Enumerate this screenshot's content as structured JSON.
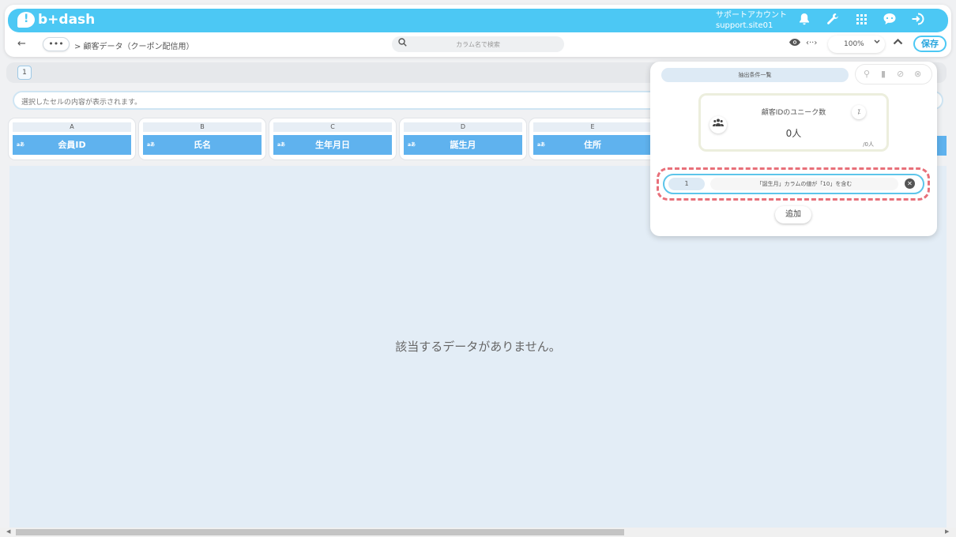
{
  "app": {
    "logo_text": "b+dash"
  },
  "account": {
    "label": "サポートアカウント",
    "id": "support.site01"
  },
  "toolbar_icons": [
    "bell-icon",
    "wrench-icon",
    "grid-icon",
    "chat-icon",
    "logout-icon"
  ],
  "nav": {
    "back": "←",
    "more": "•••",
    "breadcrumb": "> 顧客データ（クーポン配信用）",
    "search_placeholder": "カラム名で検索",
    "code_toggle": "‹··›",
    "zoom": "100%",
    "save_label": "保存"
  },
  "page": {
    "current": "1"
  },
  "cell_view_placeholder": "選択したセルの内容が表示されます。",
  "columns": [
    {
      "letter": "A",
      "type": "aあ",
      "name": "会員ID"
    },
    {
      "letter": "B",
      "type": "aあ",
      "name": "氏名"
    },
    {
      "letter": "C",
      "type": "aあ",
      "name": "生年月日"
    },
    {
      "letter": "D",
      "type": "aあ",
      "name": "誕生月"
    },
    {
      "letter": "E",
      "type": "aあ",
      "name": "住所"
    }
  ],
  "empty_message": "該当するデータがありません。",
  "panel": {
    "tab_label": "抽出条件一覧",
    "stat": {
      "title": "顧客IDのユニーク数",
      "value": "0人",
      "sub": "/0人"
    },
    "conditions": [
      {
        "number": "1",
        "text": "「誕生月」カラムの値が「10」を含む"
      }
    ],
    "add_label": "追加"
  }
}
